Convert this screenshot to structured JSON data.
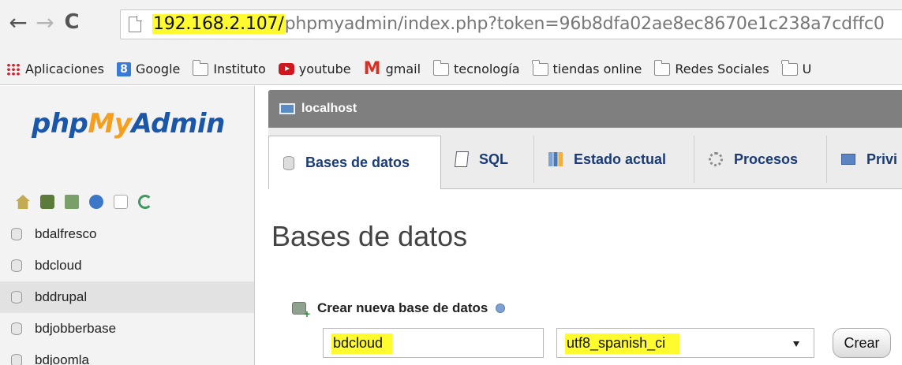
{
  "browser": {
    "url_host": "192.168.2.107/",
    "url_path": "phpmyadmin/index.php?token=96b8dfa02ae8ec8670e1c238a7cdffc0",
    "highlight_color": "#fffb2e",
    "bookmarks": [
      {
        "label": "Aplicaciones",
        "icon": "apps-icon"
      },
      {
        "label": "Google",
        "icon": "google-icon"
      },
      {
        "label": "Instituto",
        "icon": "folder-icon"
      },
      {
        "label": "youtube",
        "icon": "youtube-icon"
      },
      {
        "label": "gmail",
        "icon": "gmail-icon"
      },
      {
        "label": "tecnología",
        "icon": "folder-icon"
      },
      {
        "label": "tiendas online",
        "icon": "folder-icon"
      },
      {
        "label": "Redes Sociales",
        "icon": "folder-icon"
      },
      {
        "label": "U",
        "icon": "folder-icon"
      }
    ]
  },
  "sidebar": {
    "logo": {
      "php": "php",
      "my": "My",
      "admin": "Admin"
    },
    "databases": [
      "bdalfresco",
      "bdcloud",
      "bddrupal",
      "bdjobberbase",
      "bdjoomla"
    ],
    "hovered_index": 2
  },
  "main": {
    "server": "localhost",
    "tabs": [
      "Bases de datos",
      "SQL",
      "Estado actual",
      "Procesos",
      "Privi"
    ],
    "active_tab": 0,
    "title": "Bases de datos",
    "create_label": "Crear nueva base de datos",
    "db_name_value": "bdcloud",
    "collation_value": "utf8_spanish_ci",
    "create_button": "Crear"
  }
}
